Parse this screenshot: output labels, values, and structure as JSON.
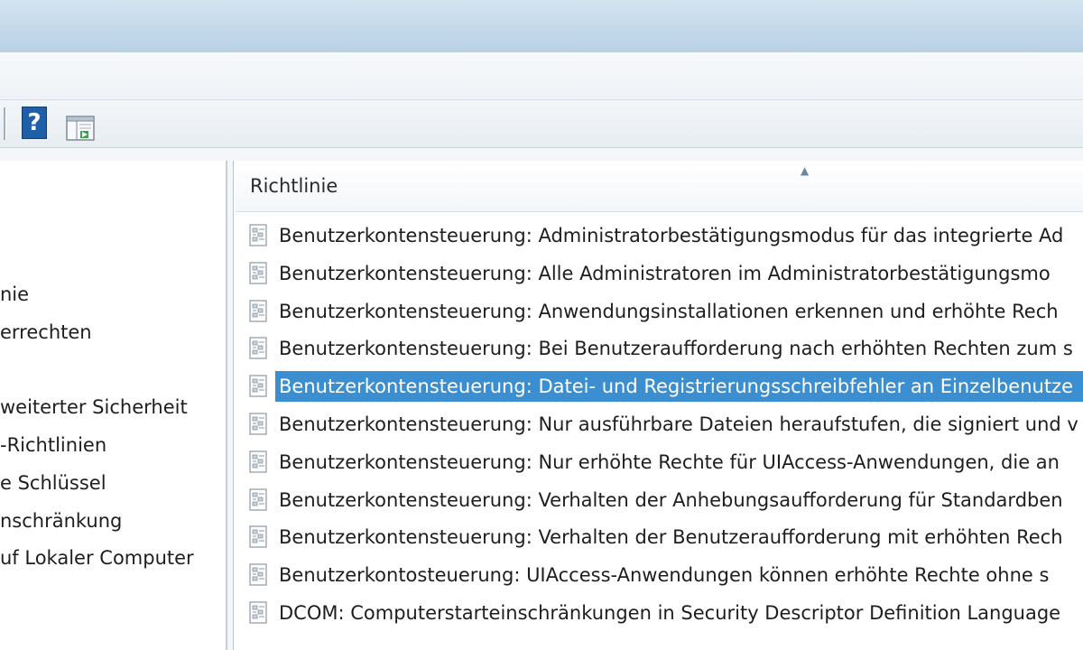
{
  "colors": {
    "selection": "#3b8fd1",
    "help_icon": "#1f5fa8"
  },
  "toolbar": {
    "help_icon": "help-icon",
    "help_glyph": "?",
    "panel_icon": "show-hide-action-pane-icon"
  },
  "tree": {
    "items": [
      "nie",
      "errechten",
      "weiterter Sicherheit",
      "-Richtlinien",
      "e Schlüssel",
      "nschränkung",
      "uf Lokaler Computer"
    ]
  },
  "list": {
    "column_header": "Richtlinie",
    "row_icon": "policy-setting-icon",
    "selected_index": 4,
    "rows": [
      "Benutzerkontensteuerung: Administratorbestätigungsmodus für das integrierte Ad",
      "Benutzerkontensteuerung: Alle Administratoren im Administratorbestätigungsmo",
      "Benutzerkontensteuerung: Anwendungsinstallationen erkennen und erhöhte Rech",
      "Benutzerkontensteuerung: Bei Benutzeraufforderung nach erhöhten Rechten zum s",
      "Benutzerkontensteuerung: Datei- und Registrierungsschreibfehler an Einzelbenutze",
      "Benutzerkontensteuerung: Nur ausführbare Dateien heraufstufen, die signiert und v",
      "Benutzerkontensteuerung: Nur erhöhte Rechte für UIAccess-Anwendungen, die an",
      "Benutzerkontensteuerung: Verhalten der Anhebungsaufforderung für Standardben",
      "Benutzerkontensteuerung: Verhalten der Benutzeraufforderung mit erhöhten Rech",
      "Benutzerkontosteuerung: UIAccess-Anwendungen können erhöhte Rechte ohne s",
      "DCOM: Computerstarteinschränkungen in Security Descriptor Definition Language"
    ]
  }
}
